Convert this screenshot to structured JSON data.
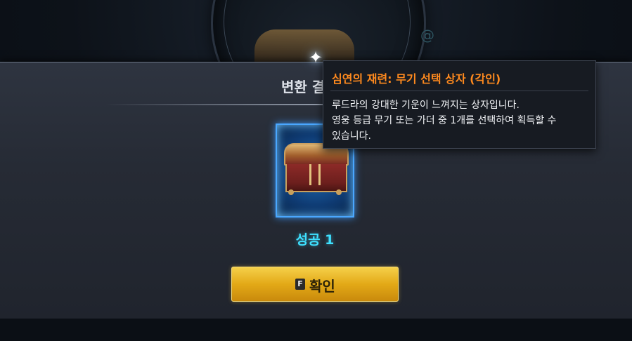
{
  "panel": {
    "title": "변환 결과"
  },
  "item": {
    "icon": "treasure-chest-icon",
    "result_text": "성공 1"
  },
  "confirm_button": {
    "key_hint": "F",
    "label": "확인"
  },
  "tooltip": {
    "title": "심연의 재련: 무기 선택 상자 (각인)",
    "lines": [
      "루드라의 강대한 기운이 느껴지는 상자입니다.",
      "영웅 등급 무기 또는 가더 중 1개를 선택하여 획득할 수",
      "있습니다."
    ]
  },
  "colors": {
    "tooltip_title": "#ff8a1e",
    "result_text": "#3ee0ff",
    "button_gold": "#e3a917",
    "card_border": "#4aa7ff"
  }
}
